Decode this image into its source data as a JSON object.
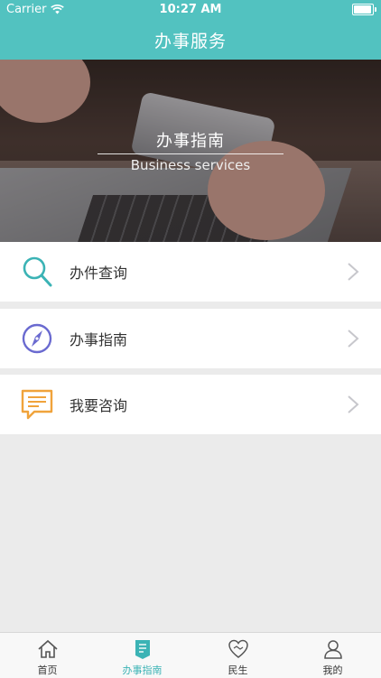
{
  "status_bar": {
    "carrier": "Carrier",
    "time": "10:27 AM"
  },
  "nav": {
    "title": "办事服务"
  },
  "banner": {
    "title": "办事指南",
    "subtitle": "Business services"
  },
  "menu": {
    "items": [
      {
        "label": "办件查询",
        "icon": "search-icon",
        "color": "#3bb3b5"
      },
      {
        "label": "办事指南",
        "icon": "compass-icon",
        "color": "#6a6ad0"
      },
      {
        "label": "我要咨询",
        "icon": "chat-icon",
        "color": "#f0a33b"
      }
    ]
  },
  "tabbar": {
    "tabs": [
      {
        "label": "首页",
        "icon": "home-icon"
      },
      {
        "label": "办事指南",
        "icon": "guide-icon",
        "active": true
      },
      {
        "label": "民生",
        "icon": "heart-handshake-icon"
      },
      {
        "label": "我的",
        "icon": "user-icon"
      }
    ]
  },
  "colors": {
    "primary": "#52c2c0",
    "active_tab": "#3bb3b5"
  }
}
